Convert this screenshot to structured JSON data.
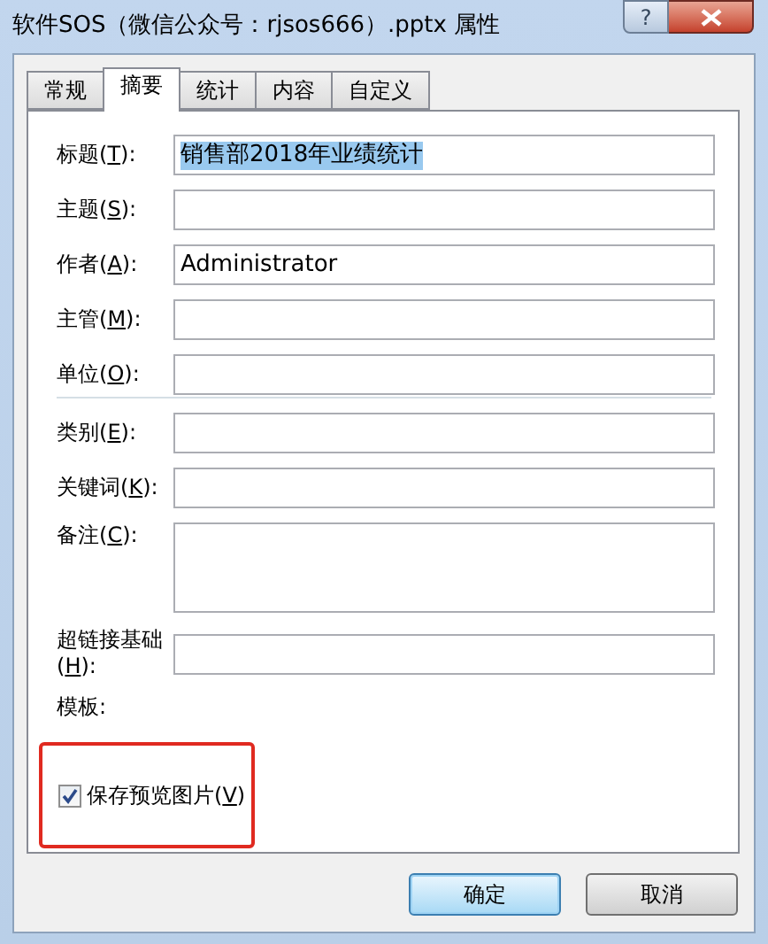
{
  "window": {
    "title": "软件SOS（微信公众号：rjsos666）.pptx 属性",
    "help": "?"
  },
  "tabs": [
    {
      "label": "常规",
      "selected": false
    },
    {
      "label": "摘要",
      "selected": true
    },
    {
      "label": "统计",
      "selected": false
    },
    {
      "label": "内容",
      "selected": false
    },
    {
      "label": "自定义",
      "selected": false
    }
  ],
  "field_groups": [
    [
      {
        "kind": "text",
        "label_before": "标题(",
        "mnemonic": "T",
        "label_after": "):",
        "value": "销售部2018年业绩统计",
        "highlighted": true
      },
      {
        "kind": "text",
        "label_before": "主题(",
        "mnemonic": "S",
        "label_after": "):"
      },
      {
        "kind": "text",
        "label_before": "作者(",
        "mnemonic": "A",
        "label_after": "):",
        "value": "Administrator",
        "highlighted": false
      },
      {
        "kind": "text",
        "label_before": "主管(",
        "mnemonic": "M",
        "label_after": "):"
      },
      {
        "kind": "text",
        "label_before": "单位(",
        "mnemonic": "O",
        "label_after": "):"
      }
    ],
    [
      {
        "kind": "text",
        "label_before": "类别(",
        "mnemonic": "E",
        "label_after": "):"
      },
      {
        "kind": "text",
        "label_before": "关键词(",
        "mnemonic": "K",
        "label_after": "):"
      },
      {
        "kind": "multiline",
        "label_before": "备注(",
        "mnemonic": "C",
        "label_after": "):"
      },
      {
        "kind": "text",
        "label_before": "超链接基础(",
        "mnemonic": "H",
        "label_after": "):"
      },
      {
        "kind": "static",
        "label_before": "模板:"
      }
    ]
  ],
  "checkbox": {
    "label_before": "保存预览图片(",
    "mnemonic": "V",
    "label_after": ")",
    "checked": true
  },
  "buttons": [
    {
      "label": "确定",
      "default": true
    },
    {
      "label": "取消",
      "default": false
    }
  ]
}
